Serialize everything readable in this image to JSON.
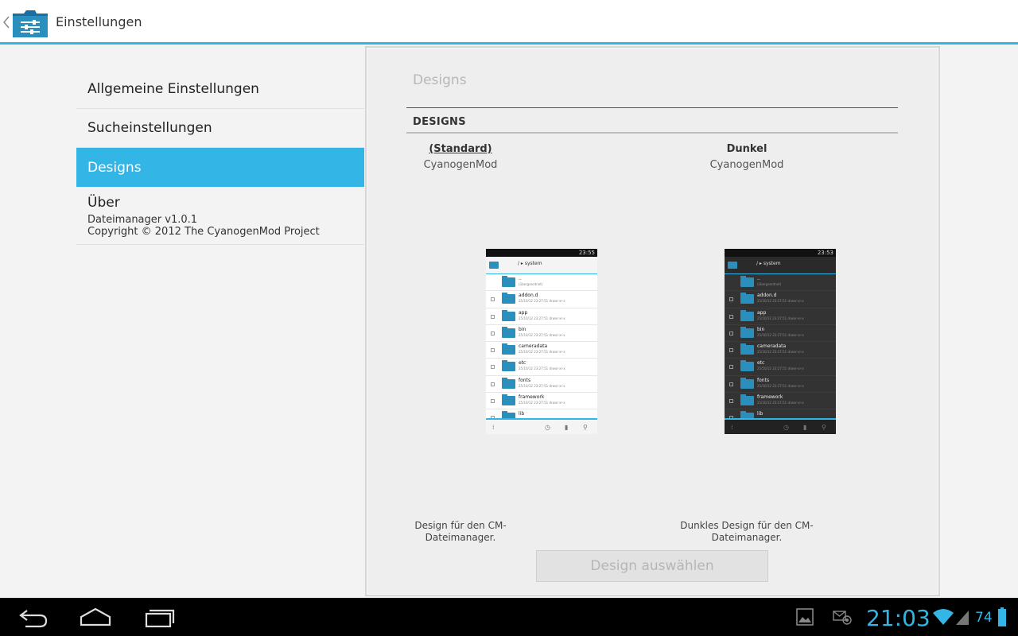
{
  "actionbar": {
    "title": "Einstellungen"
  },
  "headers": [
    {
      "title": "Allgemeine Einstellungen"
    },
    {
      "title": "Sucheinstellungen"
    },
    {
      "title": "Designs"
    },
    {
      "title": "Über",
      "summary_line1": "Dateimanager v1.0.1",
      "summary_line2": "Copyright © 2012 The CyanogenMod Project"
    }
  ],
  "panel": {
    "title": "Designs",
    "category": "DESIGNS",
    "themes": [
      {
        "name": "(Standard)",
        "author": "CyanogenMod",
        "desc_line1": "Design für den CM-",
        "desc_line2": "Dateimanager.",
        "selected": true
      },
      {
        "name": "Dunkel",
        "author": "CyanogenMod",
        "desc_line1": "Dunkles Design für den CM-",
        "desc_line2": "Dateimanager."
      }
    ],
    "select_button": "Design auswählen"
  },
  "preview": {
    "light_clock": "23:55",
    "dark_clock": "23:53",
    "path": "/  ▸ system",
    "rows": [
      {
        "name": "..",
        "meta": "(übergeordnet)"
      },
      {
        "name": "addon.d",
        "meta": "25/10/12 23:27:51  drwxr-xr-x"
      },
      {
        "name": "app",
        "meta": "25/10/12 23:27:51  drwxr-xr-x"
      },
      {
        "name": "bin",
        "meta": "25/10/12 23:27:51  drwxr-xr-x"
      },
      {
        "name": "cameradata",
        "meta": "25/10/12 23:27:51  drwxr-xr-x"
      },
      {
        "name": "etc",
        "meta": "25/10/12 23:27:51  drwxr-xr-x"
      },
      {
        "name": "fonts",
        "meta": "25/10/12 23:27:51  drwxr-xr-x"
      },
      {
        "name": "framework",
        "meta": "25/10/12 23:27:51  drwxr-xr-x"
      },
      {
        "name": "lib",
        "meta": ""
      }
    ]
  },
  "system_bar": {
    "time": "21:03",
    "battery": "74"
  },
  "colors": {
    "accent": "#33b5e5",
    "folder": "#2a8fbd",
    "selected_row": "#33b5e5"
  },
  "icons": [
    "back-icon",
    "app-settings-icon",
    "nav-back-icon",
    "nav-home-icon",
    "nav-recent-icon",
    "gallery-notification-icon",
    "mail-notification-icon",
    "wifi-icon",
    "signal-icon",
    "battery-icon"
  ]
}
